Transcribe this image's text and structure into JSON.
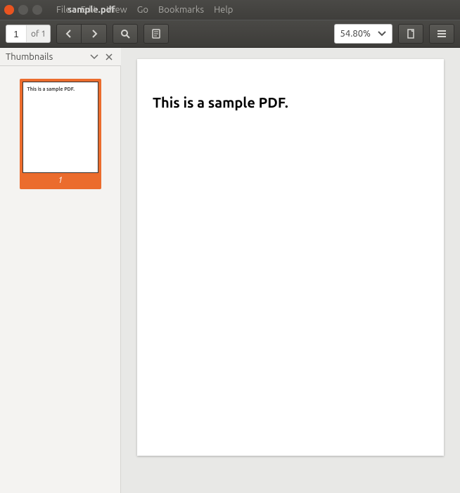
{
  "window": {
    "title": "sample.pdf"
  },
  "menubar": {
    "file": "File",
    "edit": "Edit",
    "view": "View",
    "go": "Go",
    "bookmarks": "Bookmarks",
    "help": "Help"
  },
  "toolbar": {
    "page_current": "1",
    "page_total_label": "of 1",
    "zoom_level": "54.80%"
  },
  "sidebar": {
    "header": "Thumbnails",
    "thumbnails": [
      {
        "page_number": "1",
        "preview_text": "This is a sample PDF."
      }
    ]
  },
  "document": {
    "content": "This is a sample PDF."
  }
}
